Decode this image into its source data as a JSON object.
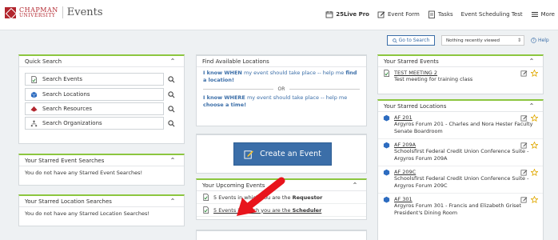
{
  "brand": {
    "logo_line1": "CHAPMAN",
    "logo_line2": "UNIVERSITY",
    "app_name": "Events"
  },
  "topnav": {
    "live_pro": "25Live Pro",
    "event_form": "Event Form",
    "tasks": "Tasks",
    "scheduling_test": "Event Scheduling Test",
    "more": "More"
  },
  "toolbar": {
    "goto_label": "Go to Search",
    "recent_value": "Nothing recently viewed",
    "help_label": "Help"
  },
  "quick_search": {
    "title": "Quick Search",
    "items": [
      {
        "label": "Search Events",
        "icon": "event-doc-icon"
      },
      {
        "label": "Search Locations",
        "icon": "location-cube-icon"
      },
      {
        "label": "Search Resources",
        "icon": "resource-icon"
      },
      {
        "label": "Search Organizations",
        "icon": "organization-icon"
      }
    ]
  },
  "starred_event_searches": {
    "title": "Your Starred Event Searches",
    "empty": "You do not have any Starred Event Searches!"
  },
  "starred_location_searches": {
    "title": "Your Starred Location Searches",
    "empty": "You do not have any Starred Location Searches!"
  },
  "find_locations": {
    "title": "Find Available Locations",
    "when_lead": "I know ",
    "when_key": "WHEN",
    "when_mid": " my event should take place -- help me ",
    "when_link": "find a location!",
    "or": "OR",
    "where_lead": "I know ",
    "where_key": "WHERE",
    "where_mid": " my event should take place -- help me ",
    "where_link": "choose a time!"
  },
  "create_event": {
    "label": "Create an Event"
  },
  "upcoming_events": {
    "title": "Your Upcoming Events",
    "rows": [
      {
        "lead": "5 Events in which you are the ",
        "role": "Requestor"
      },
      {
        "lead": "5 Events in which you are the ",
        "role": "Scheduler"
      }
    ]
  },
  "starred_events": {
    "title": "Your Starred Events",
    "items": [
      {
        "title": "TEST MEETING 2",
        "sub": "Test meeting for training class"
      }
    ]
  },
  "starred_locations": {
    "title": "Your Starred Locations",
    "items": [
      {
        "title": "AF 201",
        "sub": "Argyros Forum 201 - Charles and Nora Hester Faculty Senate Boardroom"
      },
      {
        "title": "AF 209A",
        "sub": "Schoolsfirst Federal Credit Union Conference Suite - Argyros Forum 209A"
      },
      {
        "title": "AF 209C",
        "sub": "Schoolsfirst Federal Credit Union Conference Suite - Argyros Forum 209C"
      },
      {
        "title": "AF 301",
        "sub": "Argyros Forum 301 - Francis and Elizabeth Griset President's Dining Room"
      }
    ]
  },
  "colors": {
    "brand_red": "#b2262e",
    "accent_blue": "#3b6ea8",
    "panel_green": "#8cc63f",
    "annotation_red": "#e8141c",
    "star_gold": "#e0a800"
  }
}
